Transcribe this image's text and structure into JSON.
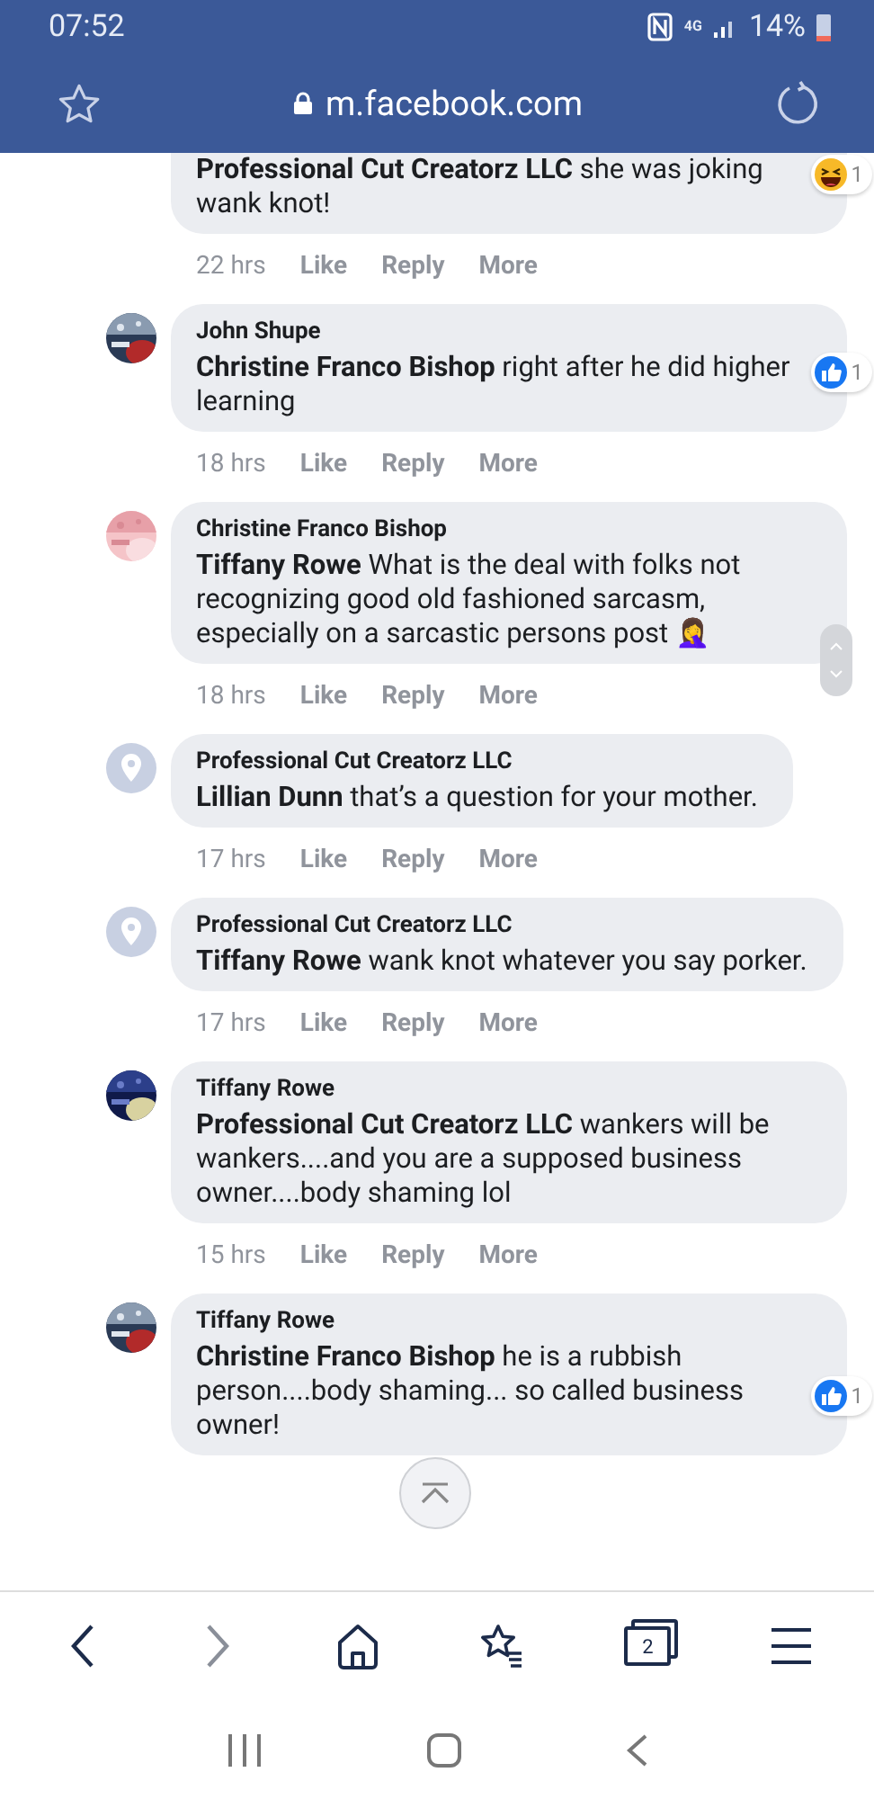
{
  "status_bar": {
    "time": "07:52",
    "network": "4G",
    "battery": "14%"
  },
  "address_bar": {
    "url": "m.facebook.com"
  },
  "comments": [
    {
      "mention": "Professional Cut Creatorz LLC",
      "text": " she was joking wank knot!",
      "time": "22 hrs",
      "actions": [
        "Like",
        "Reply",
        "More"
      ],
      "reaction": {
        "kind": "haha",
        "count": "1"
      }
    },
    {
      "author": "John Shupe",
      "mention": "Christine Franco Bishop",
      "text": " right after he did higher learning",
      "time": "18 hrs",
      "actions": [
        "Like",
        "Reply",
        "More"
      ],
      "reaction": {
        "kind": "like",
        "count": "1"
      }
    },
    {
      "author": "Christine Franco Bishop",
      "mention": "Tiffany Rowe",
      "text": " What is the deal with folks not recognizing good old fashioned sarcasm, especially on a sarcastic persons post 🤦‍♀️",
      "time": "18 hrs",
      "actions": [
        "Like",
        "Reply",
        "More"
      ]
    },
    {
      "author": "Professional Cut Creatorz LLC",
      "avatar": {
        "kind": "default"
      },
      "mention": "Lillian Dunn",
      "text": " that’s a question for your mother.",
      "time": "17 hrs",
      "actions": [
        "Like",
        "Reply",
        "More"
      ]
    },
    {
      "author": "Professional Cut Creatorz LLC",
      "avatar": {
        "kind": "default"
      },
      "mention": "Tiffany Rowe",
      "text": " wank knot whatever you say porker.",
      "time": "17 hrs",
      "actions": [
        "Like",
        "Reply",
        "More"
      ]
    },
    {
      "author": "Tiffany Rowe",
      "mention": "Professional Cut Creatorz LLC",
      "text": " wankers will be wankers....and you are a supposed business owner....body shaming lol",
      "time": "15 hrs",
      "actions": [
        "Like",
        "Reply",
        "More"
      ]
    },
    {
      "author": "Tiffany Rowe",
      "mention": "Christine Franco Bishop",
      "text": " he is a rubbish person....body shaming... so called business owner!",
      "reaction": {
        "kind": "like",
        "count": "1"
      }
    }
  ],
  "browser_nav": {
    "back_disabled": false,
    "forward_disabled": true,
    "tab_count": "2"
  }
}
